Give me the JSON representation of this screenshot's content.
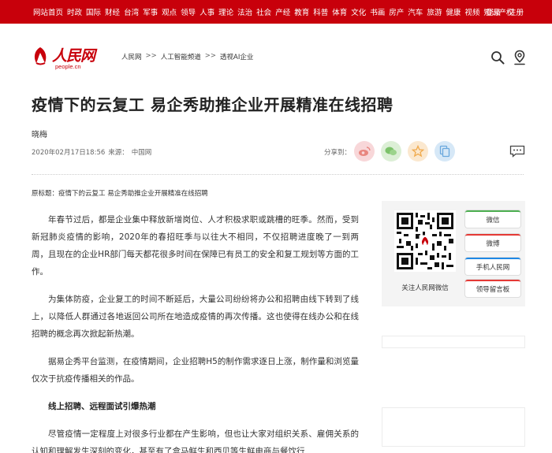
{
  "top_nav": {
    "items": [
      "网站首页",
      "时政",
      "国际",
      "财经",
      "台湾",
      "军事",
      "观点",
      "领导",
      "人事",
      "理论",
      "法治",
      "社会",
      "产经",
      "教育",
      "科普",
      "体育",
      "文化",
      "书画",
      "房产",
      "汽车",
      "旅游",
      "健康",
      "视频",
      "知识产权"
    ],
    "login": "登录",
    "register": "注册"
  },
  "logo": {
    "text": "人民网",
    "domain": "people.cn"
  },
  "breadcrumb": [
    "人民网",
    "人工智能频道",
    "透视AI企业"
  ],
  "breadcrumb_sep": ">>",
  "article": {
    "title": "疫情下的云复工 易企秀助推企业开展精准在线招聘",
    "author": "晓梅",
    "date": "2020年02月17日18:56",
    "source_label": "来源：",
    "source": "中国网",
    "share_label": "分享到：",
    "origin_title": "原标题：疫情下的云复工 易企秀助推企业开展精准在线招聘",
    "paragraphs": [
      "年春节过后，都是企业集中释放新增岗位、人才积极求职或跳槽的旺季。然而，受到新冠肺炎疫情的影响，2020年的春招旺季与以往大不相同，不仅招聘进度晚了一到两周，且现在的企业HR部门每天都花很多时间在保障已有员工的安全和复工规划等方面的工作。",
      "为集体防疫，企业复工的时间不断延后，大量公司纷纷将办公和招聘由线下转到了线上，以降低人群通过各地返回公司所在地造成疫情的再次传播。这也使得在线办公和在线招聘的概念再次掀起新热潮。",
      "据易企秀平台监测，在疫情期间，企业招聘H5的制作需求逐日上涨，制作量和浏览量仅次于抗疫传播相关的作品。"
    ],
    "subhead": "线上招聘、远程面试引爆热潮",
    "paragraph_last": "尽管疫情一定程度上对很多行业都在产生影响，但也让大家对组织关系、雇佣关系的认知和理解发生深刻的变化，甚至有了盒马鲜生和西贝等生鲜电商与餐饮行"
  },
  "sidebar": {
    "qr_caption": "关注人民网微信",
    "buttons": [
      {
        "label": "微信",
        "color": "#4caf50"
      },
      {
        "label": "微博",
        "color": "#e53935"
      },
      {
        "label": "手机人民网",
        "color": "#1e88e5"
      },
      {
        "label": "领导留言板",
        "color": "#e53935"
      }
    ]
  },
  "colors": {
    "brand_red": "#c8000b"
  }
}
